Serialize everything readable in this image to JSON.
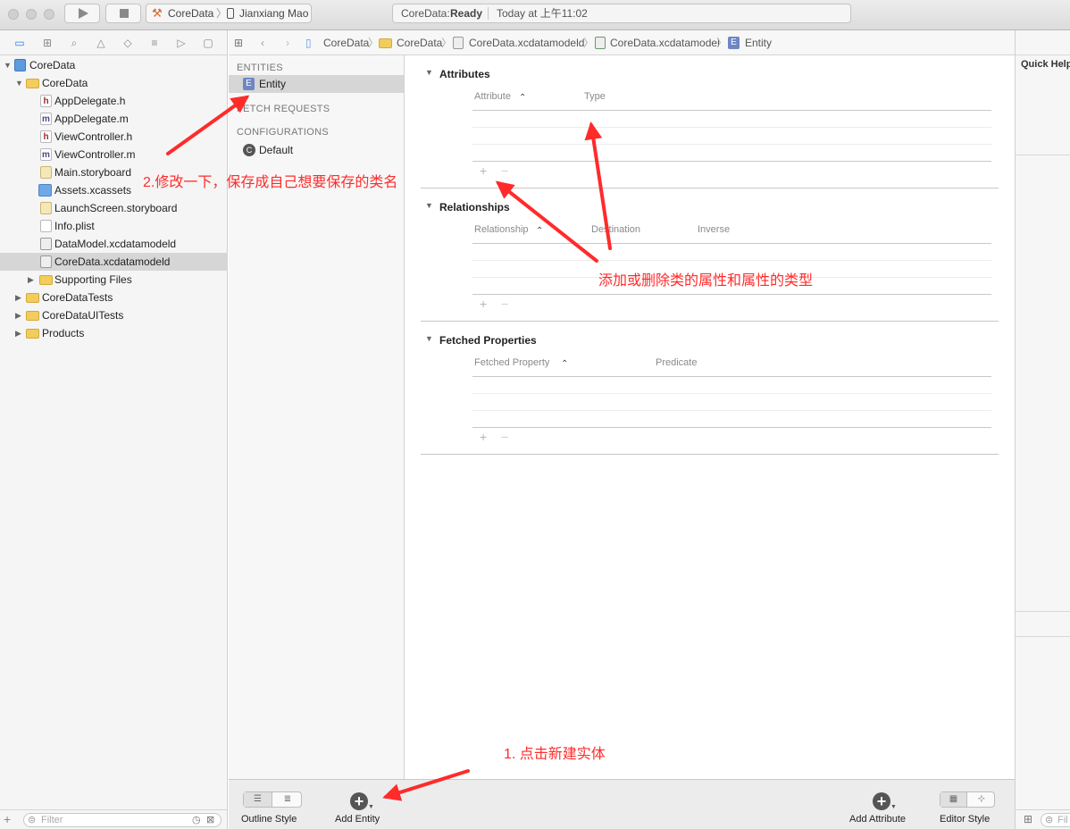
{
  "toolbar": {
    "scheme_project": "CoreData",
    "scheme_device": "Jianxiang Mao",
    "status_project": "CoreData:",
    "status_state": "Ready",
    "status_time": "Today at 上午11:02"
  },
  "navigator": {
    "items": [
      {
        "label": "CoreData",
        "icon": "project-icon"
      },
      {
        "label": "CoreData",
        "icon": "folder-icon"
      },
      {
        "label": "AppDelegate.h",
        "icon": "header-file-icon"
      },
      {
        "label": "AppDelegate.m",
        "icon": "implementation-file-icon"
      },
      {
        "label": "ViewController.h",
        "icon": "header-file-icon"
      },
      {
        "label": "ViewController.m",
        "icon": "implementation-file-icon"
      },
      {
        "label": "Main.storyboard",
        "icon": "storyboard-icon"
      },
      {
        "label": "Assets.xcassets",
        "icon": "asset-catalog-icon"
      },
      {
        "label": "LaunchScreen.storyboard",
        "icon": "storyboard-icon"
      },
      {
        "label": "Info.plist",
        "icon": "plist-icon"
      },
      {
        "label": "DataModel.xcdatamodeld",
        "icon": "data-model-icon"
      },
      {
        "label": "CoreData.xcdatamodeld",
        "icon": "data-model-icon"
      },
      {
        "label": "Supporting Files",
        "icon": "folder-icon"
      },
      {
        "label": "CoreDataTests",
        "icon": "folder-icon"
      },
      {
        "label": "CoreDataUITests",
        "icon": "folder-icon"
      },
      {
        "label": "Products",
        "icon": "folder-icon"
      }
    ],
    "filter_placeholder": "Filter"
  },
  "jumpbar": {
    "crumbs": [
      "CoreData",
      "CoreData",
      "CoreData.xcdatamodeld",
      "CoreData.xcdatamodel",
      "Entity"
    ]
  },
  "entities_pane": {
    "entities_header": "ENTITIES",
    "entity_name": "Entity",
    "fetch_header": "FETCH REQUESTS",
    "config_header": "CONFIGURATIONS",
    "config_name": "Default"
  },
  "detail": {
    "attributes": {
      "title": "Attributes",
      "col1": "Attribute",
      "col2": "Type"
    },
    "relationships": {
      "title": "Relationships",
      "col1": "Relationship",
      "col2": "Destination",
      "col3": "Inverse"
    },
    "fetched": {
      "title": "Fetched Properties",
      "col1": "Fetched Property",
      "col2": "Predicate"
    },
    "plus": "+",
    "minus": "−"
  },
  "bottombar": {
    "outline_style": "Outline Style",
    "add_entity": "Add Entity",
    "add_attribute": "Add Attribute",
    "editor_style": "Editor Style"
  },
  "inspector": {
    "quick_help": "Quick Help",
    "filter_placeholder": "Fil"
  },
  "annotations": {
    "step2": "2.修改一下，保存成自己想要保存的类名",
    "attr_note": "添加或删除类的属性和属性的类型",
    "step1": "1. 点击新建实体"
  },
  "colors": {
    "annotation": "#ff2b2b",
    "selection": "#d6d6d6"
  }
}
